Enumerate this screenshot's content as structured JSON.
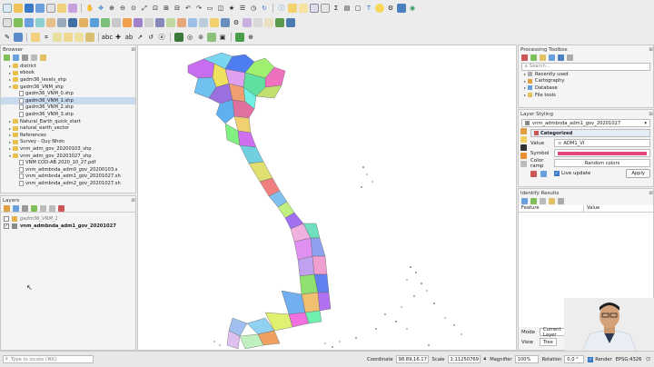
{
  "browser": {
    "title": "Browser",
    "items": [
      {
        "label": "district",
        "indent": 1,
        "kind": "folder",
        "arrow": "▸"
      },
      {
        "label": "ebook",
        "indent": 1,
        "kind": "folder",
        "arrow": "▸"
      },
      {
        "label": "gadm36_levels_shp",
        "indent": 1,
        "kind": "folder",
        "arrow": "▸"
      },
      {
        "label": "gadm36_VNM_shp",
        "indent": 1,
        "kind": "folder",
        "arrow": "▾"
      },
      {
        "label": "gadm36_VNM_0.shp",
        "indent": 2,
        "kind": "file",
        "arrow": ""
      },
      {
        "label": "gadm36_VNM_1.shp",
        "indent": 2,
        "kind": "file",
        "arrow": "",
        "selected": true
      },
      {
        "label": "gadm36_VNM_2.shp",
        "indent": 2,
        "kind": "file",
        "arrow": ""
      },
      {
        "label": "gadm36_VNM_3.shp",
        "indent": 2,
        "kind": "file",
        "arrow": ""
      },
      {
        "label": "Natural_Earth_quick_start",
        "indent": 1,
        "kind": "folder",
        "arrow": "▸"
      },
      {
        "label": "natural_earth_vector",
        "indent": 1,
        "kind": "folder",
        "arrow": "▸"
      },
      {
        "label": "References",
        "indent": 1,
        "kind": "folder",
        "arrow": "▸"
      },
      {
        "label": "Survey - Quy Nhơn",
        "indent": 1,
        "kind": "folder",
        "arrow": "▸"
      },
      {
        "label": "vnm_adm_gov_20200103_shp",
        "indent": 1,
        "kind": "folder",
        "arrow": "▸"
      },
      {
        "label": "vnm_adm_gov_20201027_shp",
        "indent": 1,
        "kind": "folder",
        "arrow": "▾"
      },
      {
        "label": "VNM COD-AB 2020_10_27.pdf",
        "indent": 2,
        "kind": "file",
        "arrow": ""
      },
      {
        "label": "vnm_admbnda_adm0_gov_20200103.s",
        "indent": 2,
        "kind": "file",
        "arrow": ""
      },
      {
        "label": "vnm_admbnda_adm1_gov_20201027.sh",
        "indent": 2,
        "kind": "file",
        "arrow": ""
      },
      {
        "label": "vnm_admbnda_adm2_gov_20201027.sh",
        "indent": 2,
        "kind": "file",
        "arrow": ""
      }
    ]
  },
  "layers": {
    "title": "Layers",
    "items": [
      {
        "label": "gadm36_VNM_1",
        "checked": false,
        "italic": true,
        "color": "#e8b24a"
      },
      {
        "label": "vnm_admbnda_adm1_gov_20201027",
        "checked": true,
        "italic": false,
        "color": "#8a8a8a"
      }
    ]
  },
  "processing": {
    "title": "Processing Toolbox",
    "search_placeholder": "Search...",
    "items": [
      "Recently used",
      "Cartography",
      "Database",
      "File tools"
    ]
  },
  "styling": {
    "title": "Layer Styling",
    "layer": "vnm_admbnda_adm1_gov_20201027",
    "renderer": "Categorized",
    "value_label": "Value",
    "value": "ADM1_VI",
    "symbol_label": "Symbol",
    "color_ramp_label": "Color ramp",
    "color_ramp_value": "Random colors",
    "live_update": "Live update",
    "apply": "Apply"
  },
  "identify": {
    "title": "Identify Results",
    "col_feature": "Feature",
    "col_value": "Value",
    "mode_label": "Mode",
    "mode_value": "Current Layer",
    "view_label": "View",
    "view_value": "Tree"
  },
  "statusbar": {
    "locate_placeholder": "Type to locate (⌘K)",
    "coordinate_label": "Coordinate",
    "coordinate_value": "98.89,16.17",
    "scale_label": "Scale",
    "scale_value": "1:11250769",
    "magnifier_label": "Magnifier",
    "magnifier_value": "100%",
    "rotation_label": "Rotation",
    "rotation_value": "0,0 °",
    "render_label": "Render",
    "crs": "EPSG:4326"
  },
  "colors": {
    "accent": "#3a78c8",
    "selected": "#c9d9ee",
    "symbol_bar": "#e0457b"
  }
}
